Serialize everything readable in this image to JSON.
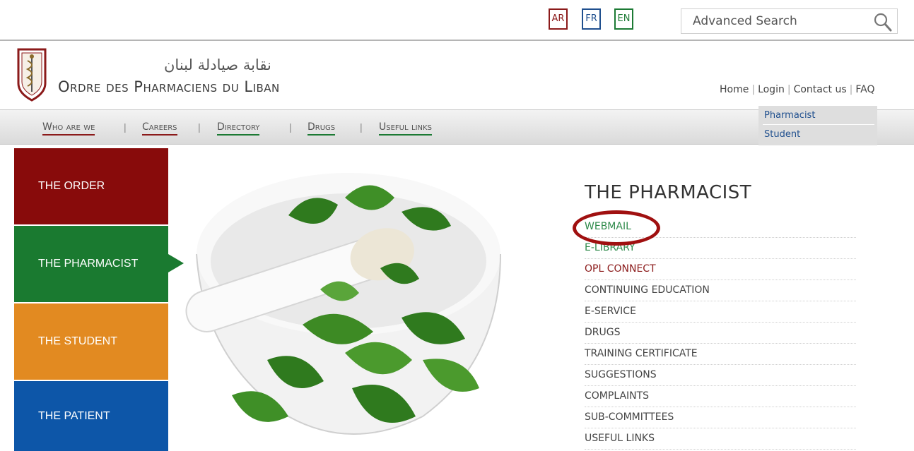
{
  "languages": [
    "AR",
    "FR",
    "EN"
  ],
  "search": {
    "placeholder": "Advanced Search"
  },
  "logo": {
    "arabic": "نقابة صيادلة لبنان",
    "french": "Ordre des Pharmaciens du Liban"
  },
  "util_links": [
    "Home",
    "Login",
    "Contact us",
    "FAQ"
  ],
  "login_menu": [
    "Pharmacist",
    "Student"
  ],
  "nav": [
    "Who are we",
    "Careers",
    "Directory",
    "Drugs",
    "Useful links"
  ],
  "tiles": [
    "THE ORDER",
    "THE PHARMACIST",
    "THE STUDENT",
    "THE PATIENT"
  ],
  "section": {
    "title": "THE PHARMACIST",
    "links": [
      "WEBMAIL",
      "E-LIBRARY",
      "OPL CONNECT",
      "CONTINUING EDUCATION",
      "E-SERVICE",
      "DRUGS",
      "TRAINING CERTIFICATE",
      "SUGGESTIONS",
      "COMPLAINTS",
      "SUB-COMMITTEES",
      "USEFUL LINKS"
    ]
  },
  "colors": {
    "red": "#880b0b",
    "green": "#1a7a30",
    "orange": "#e28a21",
    "blue": "#0d56a8"
  }
}
